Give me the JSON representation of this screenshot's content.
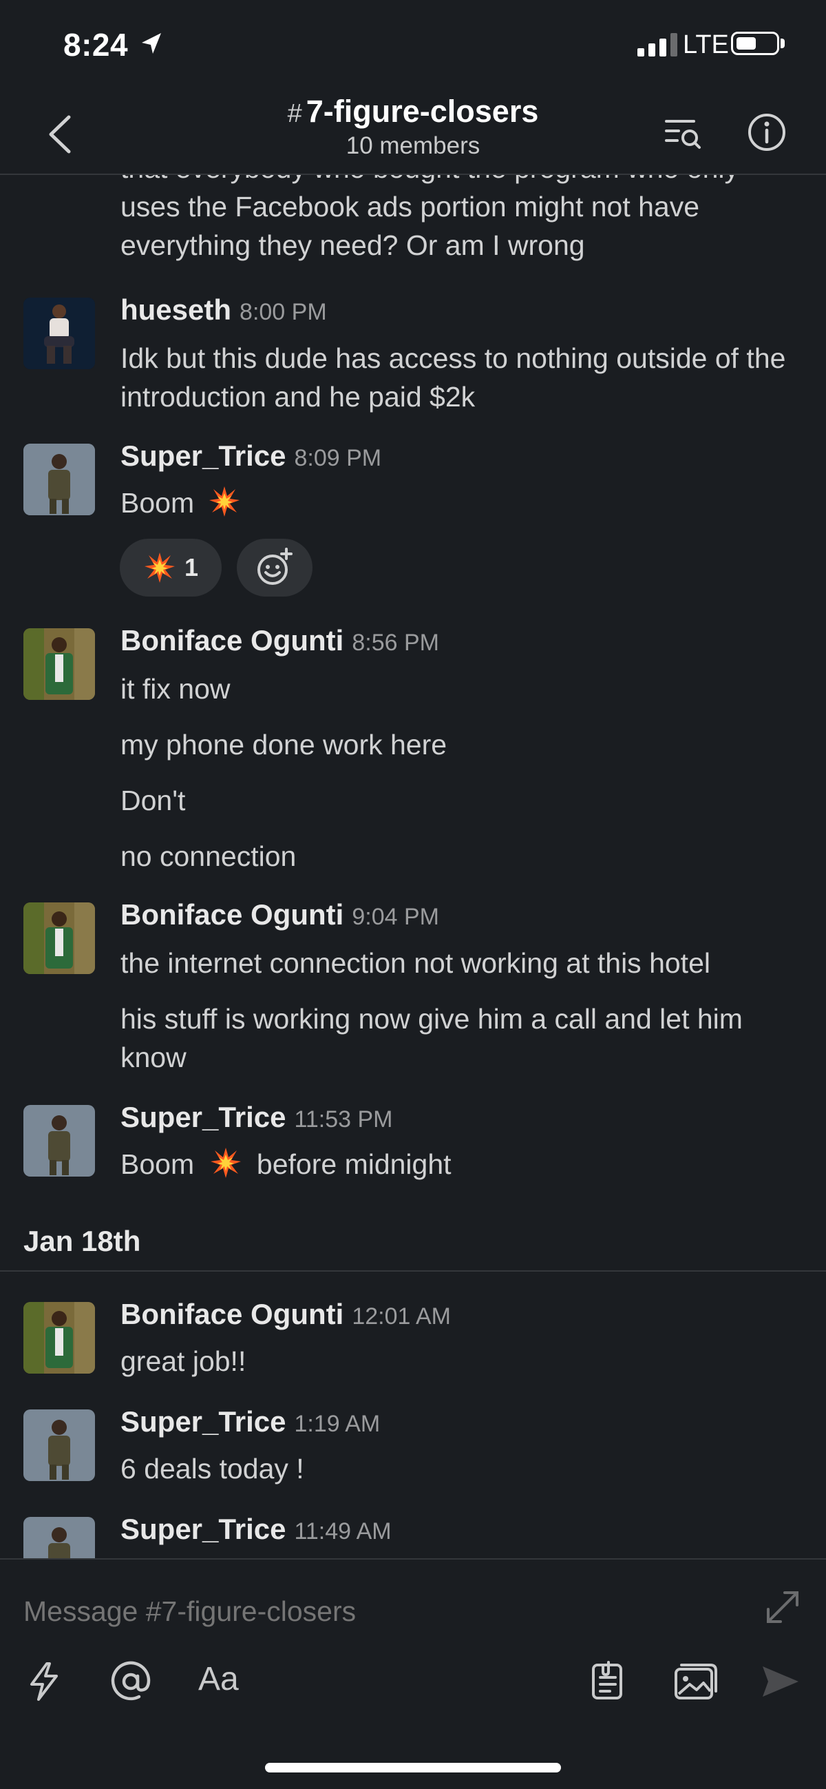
{
  "status_bar": {
    "time": "8:24",
    "network": "LTE"
  },
  "header": {
    "hash": "#",
    "channel_name": "7-figure-closers",
    "members": "10 members"
  },
  "messages": {
    "partial_top": "that everybody who bought the program who only uses the Facebook ads portion might not have everything they need? Or am I wrong",
    "m1": {
      "author": "hueseth",
      "time": "8:00 PM",
      "text": "Idk but this dude has access to nothing outside of the introduction and he paid $2k"
    },
    "m2": {
      "author": "Super_Trice",
      "time": "8:09 PM",
      "text": "Boom",
      "reaction_count": "1"
    },
    "m3": {
      "author": "Boniface Ogunti",
      "time": "8:56 PM",
      "lines": [
        "it fix now",
        "my phone done work here",
        "Don't",
        "no connection"
      ]
    },
    "m4": {
      "author": "Boniface Ogunti",
      "time": "9:04 PM",
      "lines": [
        "the internet connection not working at this hotel",
        "his stuff is working now give him a call and let him know"
      ]
    },
    "m5": {
      "author": "Super_Trice",
      "time": "11:53 PM",
      "text_before": "Boom",
      "text_after": "before midnight"
    },
    "date_separator": "Jan 18th",
    "m6": {
      "author": "Boniface Ogunti",
      "time": "12:01 AM",
      "text": "great job!!"
    },
    "m7": {
      "author": "Super_Trice",
      "time": "1:19 AM",
      "text": "6 deals today !"
    },
    "m8": {
      "author": "Super_Trice",
      "time": "11:49 AM"
    }
  },
  "composer": {
    "placeholder": "Message #7-figure-closers",
    "format_label": "Aa"
  },
  "colors": {
    "background": "#1a1d21",
    "text": "#d1d2d3",
    "muted": "#9a9b9d",
    "accent": "#ff8c2a"
  }
}
